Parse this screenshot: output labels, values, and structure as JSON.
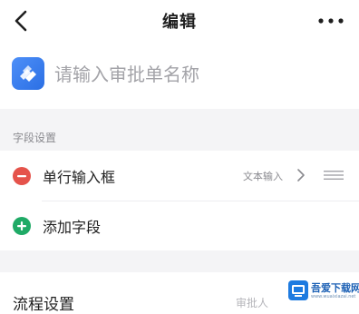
{
  "navbar": {
    "title": "编辑"
  },
  "form": {
    "name_placeholder": "请输入审批单名称",
    "name_value": ""
  },
  "fields_section": {
    "label": "字段设置",
    "fields": [
      {
        "name": "单行输入框",
        "type": "文本输入"
      }
    ],
    "add_label": "添加字段"
  },
  "process": {
    "title": "流程设置",
    "value": "审批人"
  },
  "watermark": {
    "text": "吾爱下载网",
    "url": "www.wuaixiazai.net"
  },
  "colors": {
    "app_icon": "#3a7ff0",
    "remove": "#e5534b",
    "add": "#1faa66"
  }
}
